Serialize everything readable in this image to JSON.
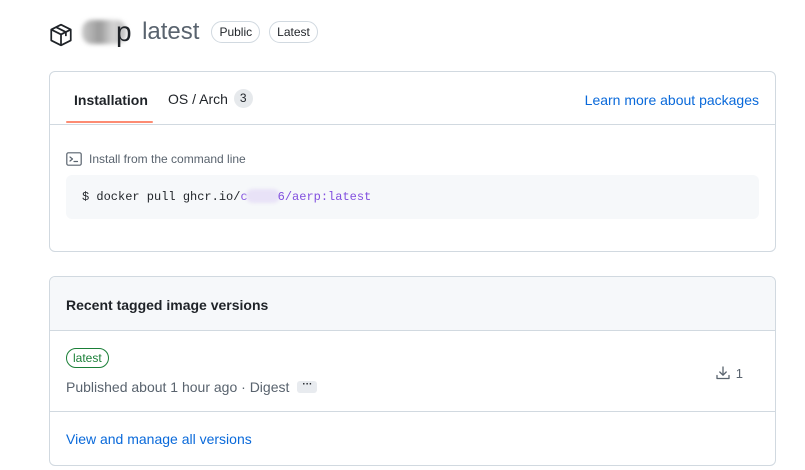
{
  "header": {
    "name_visible_suffix": "p",
    "tag": "latest",
    "badges": [
      "Public",
      "Latest"
    ],
    "icon": "package-icon"
  },
  "tabs": {
    "installation": "Installation",
    "os_arch": "OS / Arch",
    "os_arch_count": "3",
    "learn_link": "Learn more about packages"
  },
  "install": {
    "label": "Install from the command line",
    "icon": "terminal-icon",
    "command_prefix": "$ docker pull ghcr.io/",
    "command_owner_start": "c",
    "command_owner_end": "6",
    "command_rest": "/aerp:latest"
  },
  "versions": {
    "title": "Recent tagged image versions",
    "items": [
      {
        "label": "latest",
        "published": "Published about 1 hour ago · Digest",
        "more": "···",
        "downloads": "1"
      }
    ],
    "view_all": "View and manage all versions"
  },
  "colors": {
    "link": "#0969da",
    "tab_underline": "#fd8c73",
    "version_label": "#1a7f37",
    "command_accent": "#8250df"
  }
}
